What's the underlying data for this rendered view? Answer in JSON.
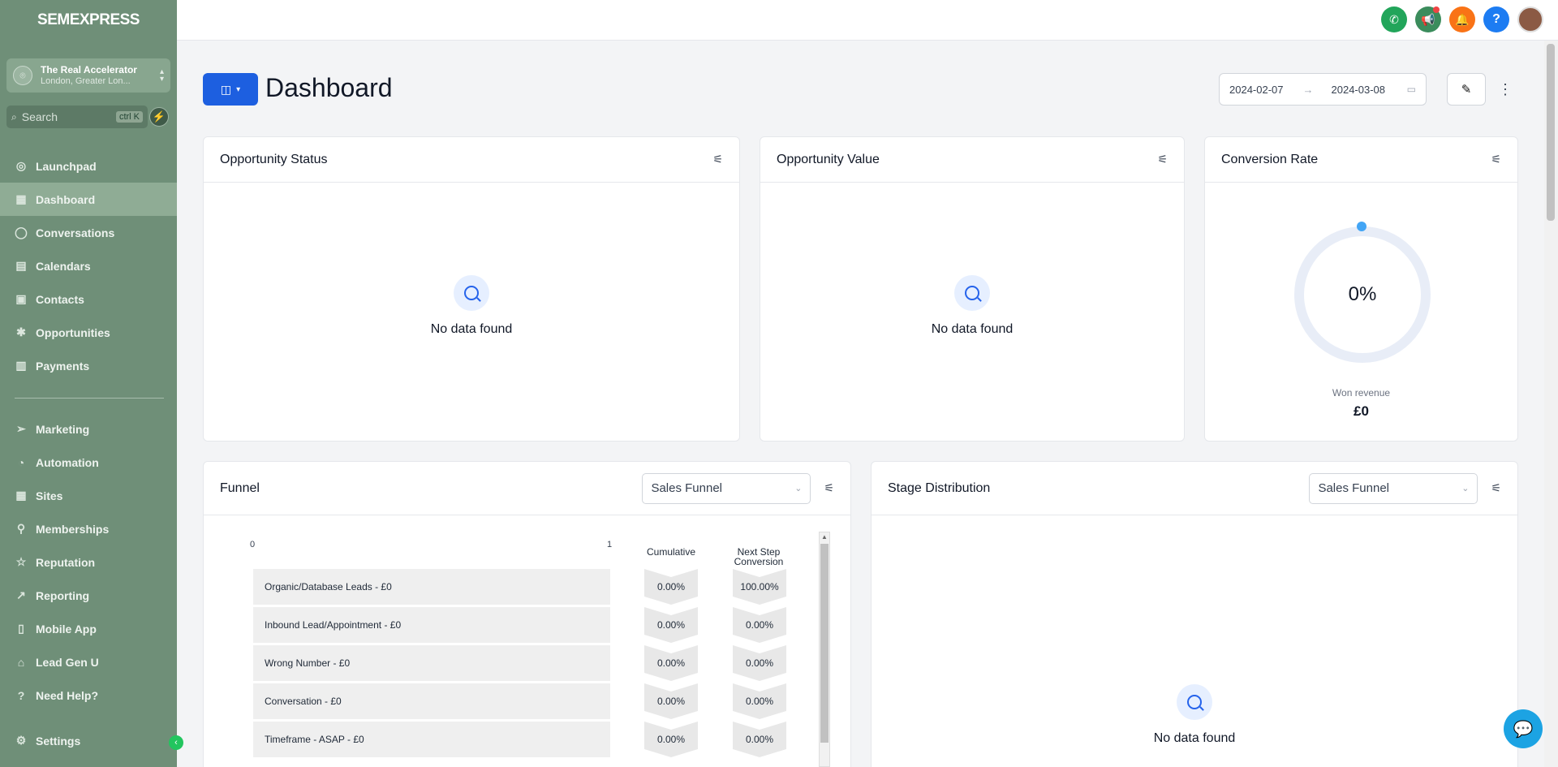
{
  "sidebar": {
    "logo": "SEMEXPRESS",
    "account": {
      "name": "The Real Accelerator",
      "location": "London, Greater Lon..."
    },
    "search": {
      "placeholder": "Search",
      "shortcut": "ctrl K"
    },
    "items": [
      {
        "label": "Launchpad",
        "icon": "launchpad-icon",
        "glyph": "◎"
      },
      {
        "label": "Dashboard",
        "icon": "dashboard-icon",
        "glyph": "▦",
        "active": true
      },
      {
        "label": "Conversations",
        "icon": "chat-icon",
        "glyph": "◯"
      },
      {
        "label": "Calendars",
        "icon": "calendar-icon",
        "glyph": "▤"
      },
      {
        "label": "Contacts",
        "icon": "contacts-icon",
        "glyph": "▣"
      },
      {
        "label": "Opportunities",
        "icon": "opportunities-icon",
        "glyph": "✱"
      },
      {
        "label": "Payments",
        "icon": "payments-icon",
        "glyph": "▥"
      }
    ],
    "items2": [
      {
        "label": "Marketing",
        "icon": "send-icon",
        "glyph": "➢"
      },
      {
        "label": "Automation",
        "icon": "automation-icon",
        "glyph": "◔"
      },
      {
        "label": "Sites",
        "icon": "sites-icon",
        "glyph": "▦"
      },
      {
        "label": "Memberships",
        "icon": "award-icon",
        "glyph": "⚲"
      },
      {
        "label": "Reputation",
        "icon": "star-icon",
        "glyph": "☆"
      },
      {
        "label": "Reporting",
        "icon": "trend-icon",
        "glyph": "↗"
      },
      {
        "label": "Mobile App",
        "icon": "mobile-icon",
        "glyph": "▯"
      },
      {
        "label": "Lead Gen U",
        "icon": "bank-icon",
        "glyph": "⌂"
      },
      {
        "label": "Need Help?",
        "icon": "question-icon",
        "glyph": "?"
      }
    ],
    "settings": {
      "label": "Settings",
      "icon": "gear-icon",
      "glyph": "⚙"
    }
  },
  "header": {
    "title": "Dashboard",
    "date_start": "2024-02-07",
    "date_end": "2024-03-08"
  },
  "cards": {
    "opportunity_status": {
      "title": "Opportunity Status",
      "empty": "No data found"
    },
    "opportunity_value": {
      "title": "Opportunity Value",
      "empty": "No data found"
    },
    "conversion_rate": {
      "title": "Conversion Rate",
      "value": "0%",
      "won_label": "Won revenue",
      "won_value": "£0"
    },
    "funnel": {
      "title": "Funnel",
      "select": "Sales Funnel",
      "axis_min": "0",
      "axis_max": "1",
      "col_cumulative": "Cumulative",
      "col_next": "Next Step Conversion",
      "rows": [
        {
          "label": "Organic/Database Leads - £0",
          "cumulative": "0.00%",
          "next": "100.00%"
        },
        {
          "label": "Inbound Lead/Appointment - £0",
          "cumulative": "0.00%",
          "next": "0.00%"
        },
        {
          "label": "Wrong Number - £0",
          "cumulative": "0.00%",
          "next": "0.00%"
        },
        {
          "label": "Conversation - £0",
          "cumulative": "0.00%",
          "next": "0.00%"
        },
        {
          "label": "Timeframe - ASAP - £0",
          "cumulative": "0.00%",
          "next": "0.00%"
        }
      ]
    },
    "stage_distribution": {
      "title": "Stage Distribution",
      "select": "Sales Funnel",
      "empty": "No data found"
    }
  },
  "colors": {
    "sidebar": "#6f8f78",
    "primary": "#1d5fe0",
    "accent_ring": "#42a5f5"
  }
}
